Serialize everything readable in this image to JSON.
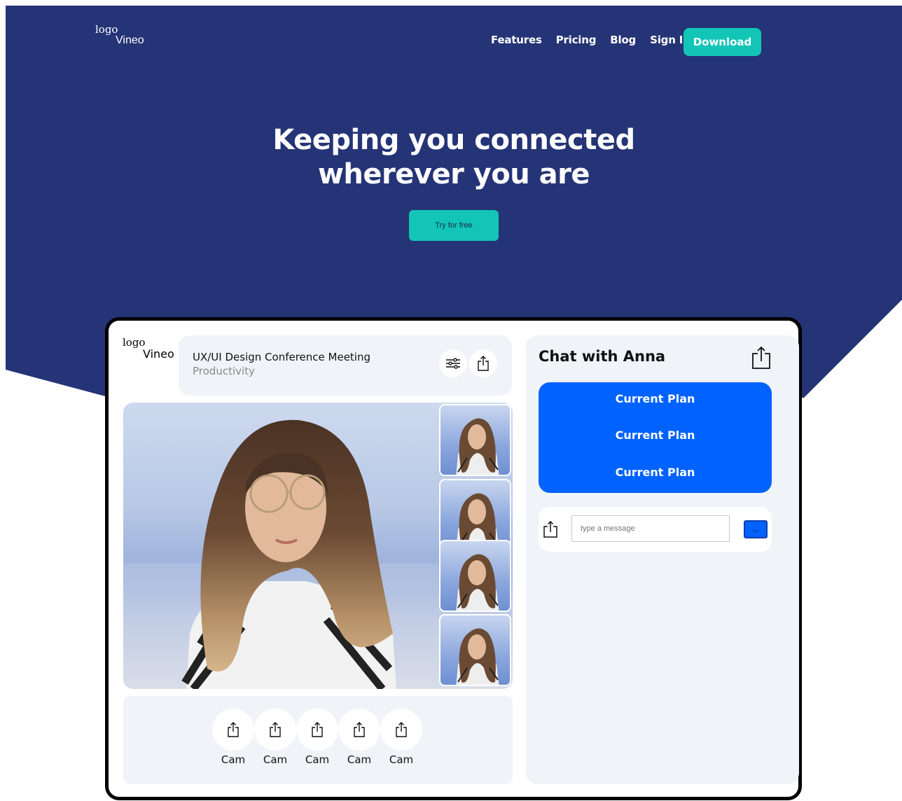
{
  "colors": {
    "navy": "#253476",
    "teal": "#12c5b7",
    "blue": "#0062ff",
    "panel": "#f0f3f8"
  },
  "nav": {
    "logo_word": "logo",
    "brand": "Vineo",
    "links": [
      "Features",
      "Pricing",
      "Blog",
      "Sign In"
    ],
    "download_label": "Download"
  },
  "hero": {
    "title_line1": "Keeping you connected",
    "title_line2": "wherever you are",
    "cta_label": "Try for free"
  },
  "app": {
    "logo_word": "logo",
    "brand": "Vineo",
    "meeting": {
      "title": "UX/UI Design Conference Meeting",
      "subtitle": "Productivity",
      "icons": [
        "sliders-icon",
        "share-icon"
      ]
    },
    "video": {
      "main_icon": "participant-video",
      "thumbnails": 4
    },
    "cams": [
      {
        "label": "Cam",
        "icon": "share-icon"
      },
      {
        "label": "Cam",
        "icon": "share-icon"
      },
      {
        "label": "Cam",
        "icon": "share-icon"
      },
      {
        "label": "Cam",
        "icon": "share-icon"
      },
      {
        "label": "Cam",
        "icon": "share-icon"
      }
    ],
    "chat": {
      "title": "Chat with Anna",
      "plans": [
        "Current Plan",
        "Current Plan",
        "Current Plan"
      ],
      "message_placeholder": "type a message",
      "send_label": "⌴"
    }
  }
}
